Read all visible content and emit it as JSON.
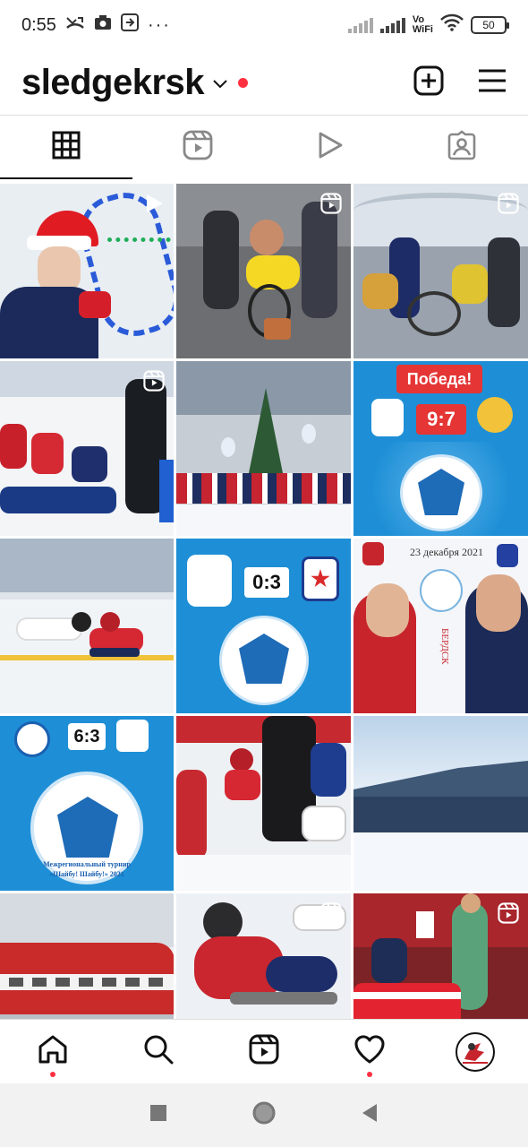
{
  "status_bar": {
    "time": "0:55",
    "left_icons": [
      "missed-call-icon",
      "camera-icon",
      "screen-record-icon",
      "more-dots-icon"
    ],
    "right_icons": [
      "signal-icon",
      "signal-icon",
      "vowifi-icon",
      "wifi-icon",
      "battery-icon"
    ],
    "dots": "···",
    "vowifi_top": "Vo",
    "vowifi_bottom": "WiFi",
    "battery": "50"
  },
  "header": {
    "username": "sledgekrsk",
    "icons": [
      "chevron-down-icon",
      "new-post-icon",
      "menu-icon"
    ]
  },
  "tabs": [
    {
      "name": "tab-grid",
      "icon": "grid-icon",
      "active": true
    },
    {
      "name": "tab-reels",
      "icon": "reels-icon",
      "active": false
    },
    {
      "name": "tab-videos",
      "icon": "play-icon",
      "active": false
    },
    {
      "name": "tab-tagged",
      "icon": "tagged-icon",
      "active": false
    }
  ],
  "posts": [
    {
      "scene": "Boy in Santa hat with tinsel",
      "badge": "play-icon"
    },
    {
      "scene": "Wheelchair party with players",
      "badge": "reels-icon"
    },
    {
      "scene": "Wheelchair users in tent hall",
      "badge": "reels-icon"
    },
    {
      "scene": "Sledge hockey players on ice",
      "badge": "reels-icon"
    },
    {
      "scene": "Team photo at Christmas tree",
      "badge": ""
    },
    {
      "scene": "Match result graphic",
      "badge": "",
      "title": "Победа!",
      "score": "9:7"
    },
    {
      "scene": "Sledge hockey game action",
      "badge": ""
    },
    {
      "scene": "Match score graphic",
      "badge": "",
      "score": "0:3"
    },
    {
      "scene": "Two coaches poster",
      "badge": "",
      "date": "23 декабря 2021",
      "city": "БЕРДСК"
    },
    {
      "scene": "Tournament score graphic",
      "badge": "",
      "score": "6:3",
      "tournament": "Межрегиональный турнир «Шайбу! Шайбу!» 2021"
    },
    {
      "scene": "Players at faceoff",
      "badge": ""
    },
    {
      "scene": "Ice arena in winter",
      "badge": ""
    },
    {
      "scene": "Red train on platform",
      "badge": ""
    },
    {
      "scene": "Player in helmet on sledge",
      "badge": "reels-icon"
    },
    {
      "scene": "Locker room with team",
      "badge": "reels-icon"
    }
  ],
  "bottom_nav": [
    {
      "name": "nav-home",
      "icon": "home-icon",
      "dot": true
    },
    {
      "name": "nav-search",
      "icon": "search-icon",
      "dot": false
    },
    {
      "name": "nav-reels",
      "icon": "reels-icon",
      "dot": false
    },
    {
      "name": "nav-activity",
      "icon": "heart-icon",
      "dot": true
    },
    {
      "name": "nav-profile",
      "icon": "profile-avatar",
      "dot": false
    }
  ],
  "system_nav": [
    "recents-square-icon",
    "home-circle-icon",
    "back-triangle-icon"
  ],
  "colors": {
    "accent_red": "#ff3040",
    "graphic_blue": "#1e8fd6",
    "text": "#111111"
  }
}
